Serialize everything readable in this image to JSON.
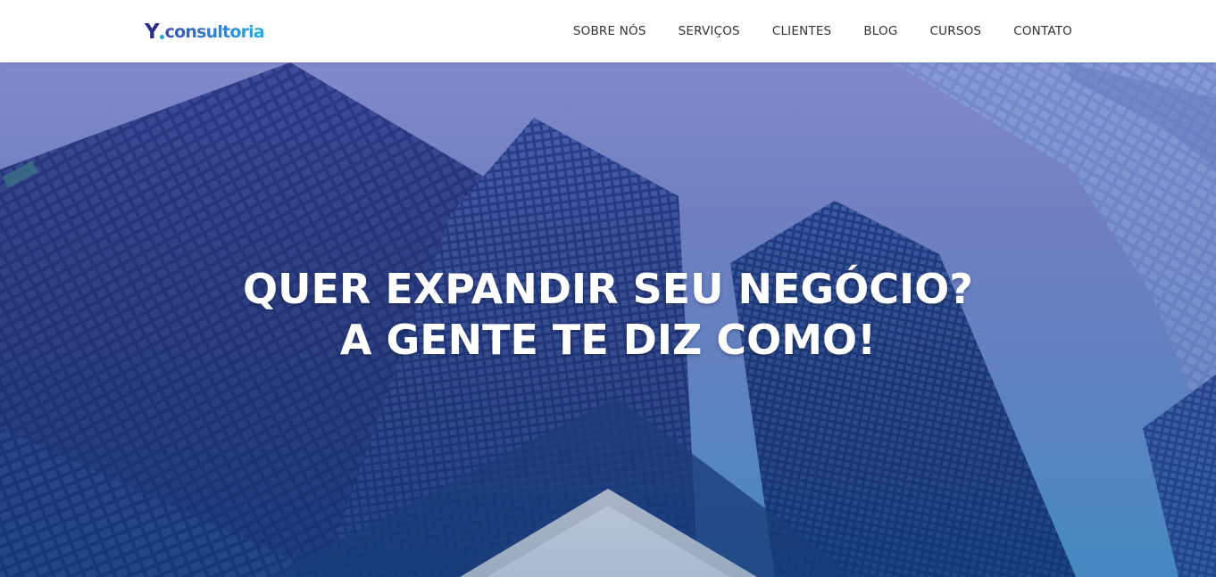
{
  "brand": {
    "logo_mark": "Y",
    "logo_text": "consultoria"
  },
  "nav": {
    "items": [
      {
        "label": "SOBRE NÓS"
      },
      {
        "label": "SERVIÇOS"
      },
      {
        "label": "CLIENTES"
      },
      {
        "label": "BLOG"
      },
      {
        "label": "CURSOS"
      },
      {
        "label": "CONTATO"
      }
    ]
  },
  "hero": {
    "headline_line1": "QUER EXPANDIR SEU NEGÓCIO?",
    "headline_line2": "A GENTE TE DIZ COMO!"
  },
  "colors": {
    "logo_dark": "#2a2f84",
    "logo_accent": "#1aa6de",
    "nav_text": "#333333",
    "hero_text": "#ffffff"
  }
}
